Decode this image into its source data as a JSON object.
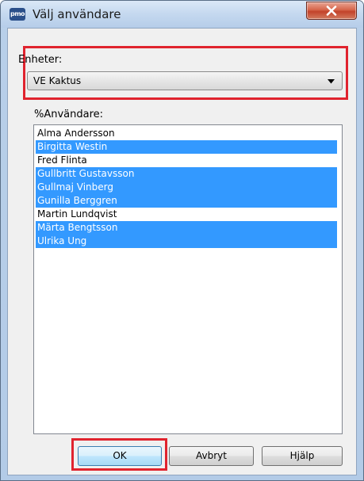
{
  "window": {
    "title": "Välj användare",
    "app_icon_text": "pmo",
    "close_icon": "close-x-icon"
  },
  "units": {
    "label": "Enheter:",
    "selected": "VE Kaktus",
    "dropdown_icon": "chevron-down-icon"
  },
  "users": {
    "label": "%Användare:",
    "items": [
      {
        "name": "Alma Andersson",
        "selected": false
      },
      {
        "name": "Birgitta Westin",
        "selected": true
      },
      {
        "name": "Fred Flinta",
        "selected": false
      },
      {
        "name": "Gullbritt Gustavsson",
        "selected": true
      },
      {
        "name": "Gullmaj Vinberg",
        "selected": true
      },
      {
        "name": "Gunilla Berggren",
        "selected": true
      },
      {
        "name": "Martin Lundqvist",
        "selected": false
      },
      {
        "name": "Märta Bengtsson",
        "selected": true
      },
      {
        "name": "Ulrika Ung",
        "selected": true
      }
    ]
  },
  "buttons": {
    "ok": "OK",
    "cancel": "Avbryt",
    "help": "Hjälp"
  },
  "colors": {
    "selection": "#3399ff",
    "highlight_box": "#e0232e"
  }
}
